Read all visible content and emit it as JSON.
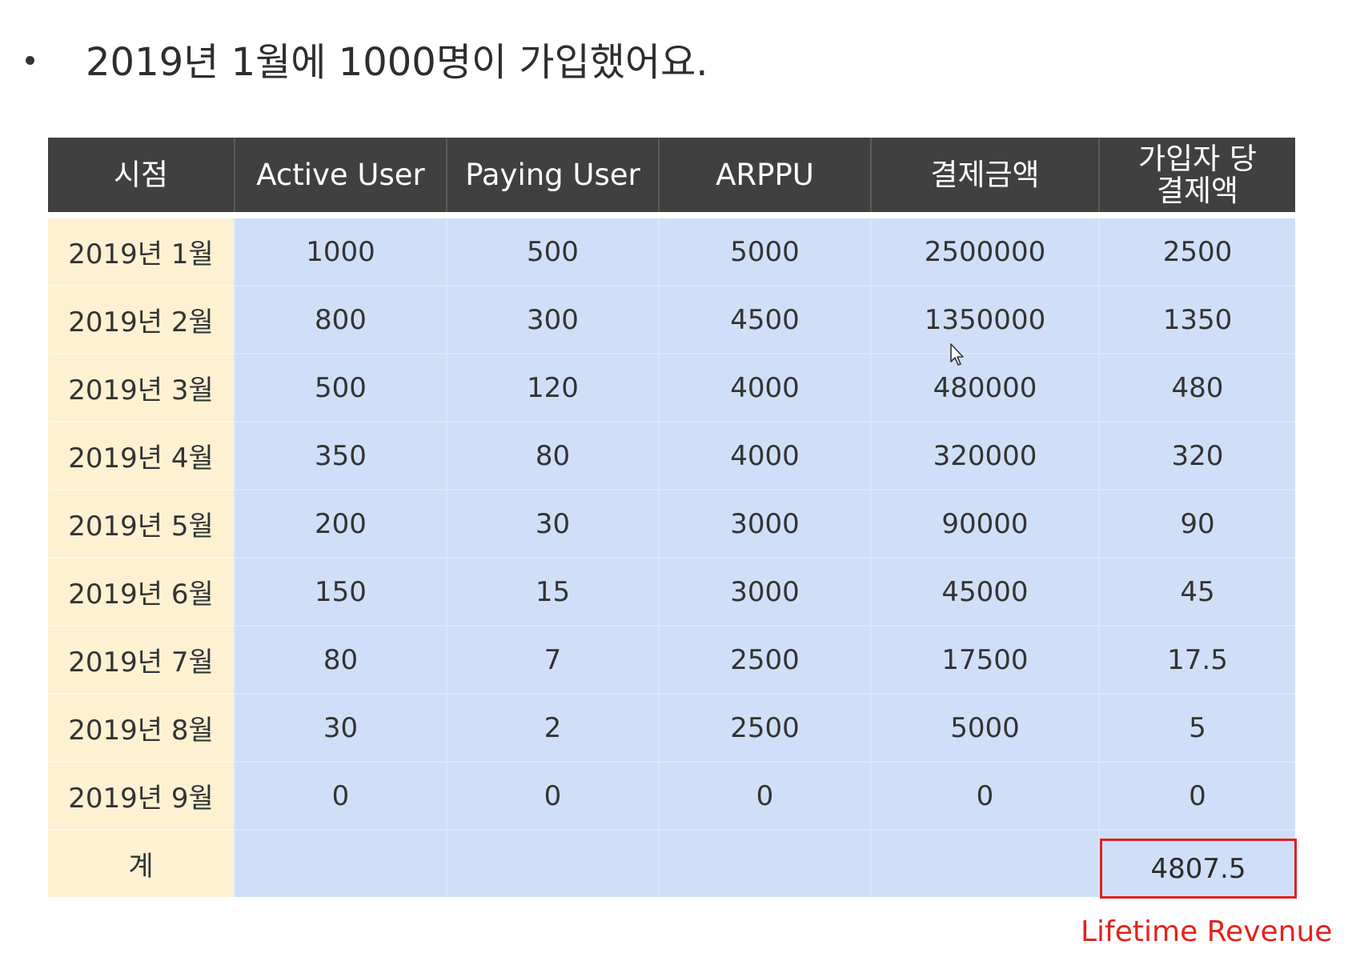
{
  "bullet": {
    "text": "2019년 1월에 1000명이 가입했어요."
  },
  "table": {
    "headers": [
      "시점",
      "Active User",
      "Paying User",
      "ARPPU",
      "결제금액",
      "가입자 당\n결제액"
    ],
    "rows": [
      [
        "2019년 1월",
        "1000",
        "500",
        "5000",
        "2500000",
        "2500"
      ],
      [
        "2019년 2월",
        "800",
        "300",
        "4500",
        "1350000",
        "1350"
      ],
      [
        "2019년 3월",
        "500",
        "120",
        "4000",
        "480000",
        "480"
      ],
      [
        "2019년 4월",
        "350",
        "80",
        "4000",
        "320000",
        "320"
      ],
      [
        "2019년 5월",
        "200",
        "30",
        "3000",
        "90000",
        "90"
      ],
      [
        "2019년 6월",
        "150",
        "15",
        "3000",
        "45000",
        "45"
      ],
      [
        "2019년 7월",
        "80",
        "7",
        "2500",
        "17500",
        "17.5"
      ],
      [
        "2019년 8월",
        "30",
        "2",
        "2500",
        "5000",
        "5"
      ],
      [
        "2019년 9월",
        "0",
        "0",
        "0",
        "0",
        "0"
      ]
    ],
    "total_label": "계",
    "total_value": "4807.5"
  },
  "annotation": {
    "label": "Lifetime Revenue",
    "color": "#e3231c"
  },
  "colors": {
    "header_bg": "#404040",
    "period_bg": "#fdf1d1",
    "cell_bg": "#cfdff7",
    "highlight_border": "#e02020"
  }
}
